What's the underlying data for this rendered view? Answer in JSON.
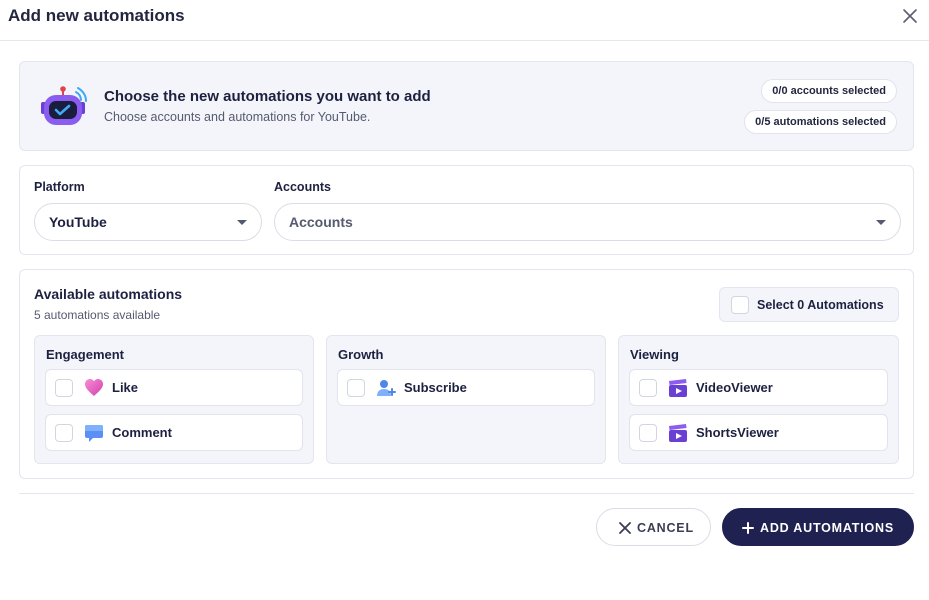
{
  "modal": {
    "title": "Add new automations"
  },
  "banner": {
    "title": "Choose the new automations you want to add",
    "subtitle": "Choose accounts and automations for YouTube.",
    "accounts_selected": "0/0 accounts selected",
    "automations_selected": "0/5 automations selected"
  },
  "platform": {
    "label": "Platform",
    "value": "YouTube"
  },
  "accounts": {
    "label": "Accounts",
    "placeholder": "Accounts"
  },
  "automations": {
    "title": "Available automations",
    "subtitle": "5 automations available",
    "select_all_label": "Select 0 Automations",
    "groups": [
      {
        "title": "Engagement",
        "items": [
          {
            "label": "Like",
            "icon": "heart-icon"
          },
          {
            "label": "Comment",
            "icon": "comment-icon"
          }
        ]
      },
      {
        "title": "Growth",
        "items": [
          {
            "label": "Subscribe",
            "icon": "add-user-icon"
          }
        ]
      },
      {
        "title": "Viewing",
        "items": [
          {
            "label": "VideoViewer",
            "icon": "video-clapper-icon"
          },
          {
            "label": "ShortsViewer",
            "icon": "video-clapper-icon"
          }
        ]
      }
    ]
  },
  "footer": {
    "cancel_label": "CANCEL",
    "add_label": "ADD AUTOMATIONS"
  },
  "colors": {
    "primary": "#1f2150",
    "panel_bg": "#f3f5fa",
    "border": "#e3e6ee"
  }
}
